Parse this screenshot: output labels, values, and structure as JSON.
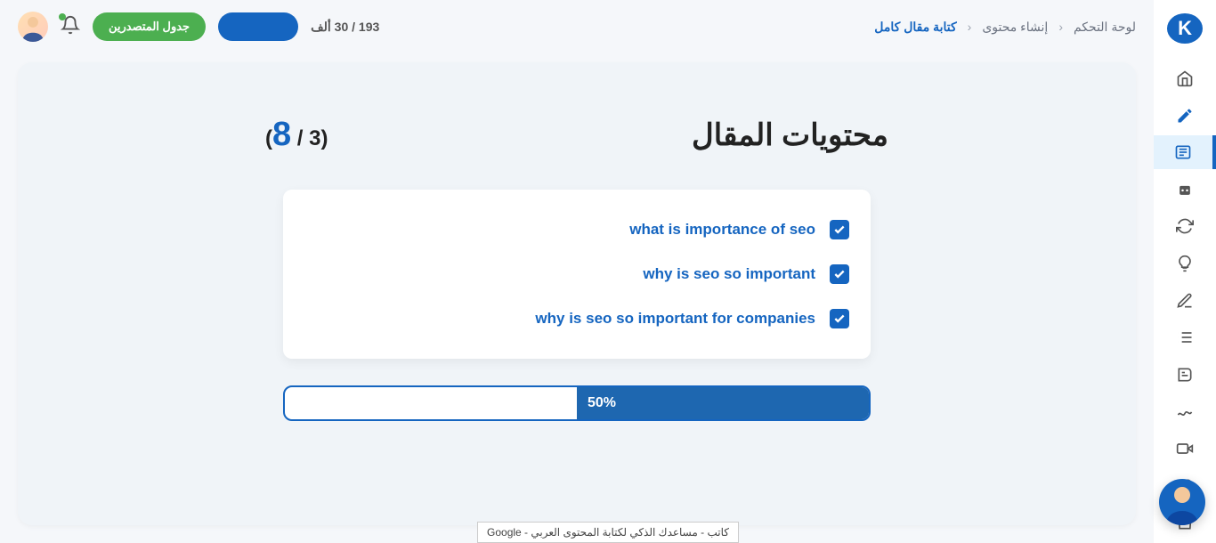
{
  "sidebar": {
    "logo_letter": "K"
  },
  "topbar": {
    "breadcrumbs": {
      "root": "لوحة التحكم",
      "mid": "إنشاء محتوى",
      "current": "كتابة مقال كامل"
    },
    "counter_text": "193 / 30 ألف",
    "leaderboard_label": "جدول المتصدرين"
  },
  "main": {
    "title": "محتويات المقال",
    "step": {
      "current": "8",
      "total": "3",
      "open": "(",
      "sep": " / ",
      "close": ")"
    },
    "items": [
      {
        "label": "what is importance of seo",
        "checked": true
      },
      {
        "label": "why is seo so important",
        "checked": true
      },
      {
        "label": "why is seo so important for companies",
        "checked": true
      }
    ],
    "progress": {
      "percent": 50,
      "label": "50%"
    }
  },
  "tooltip": "Google - كاتب - مساعدك الذكي لكتابة المحتوى العربي"
}
